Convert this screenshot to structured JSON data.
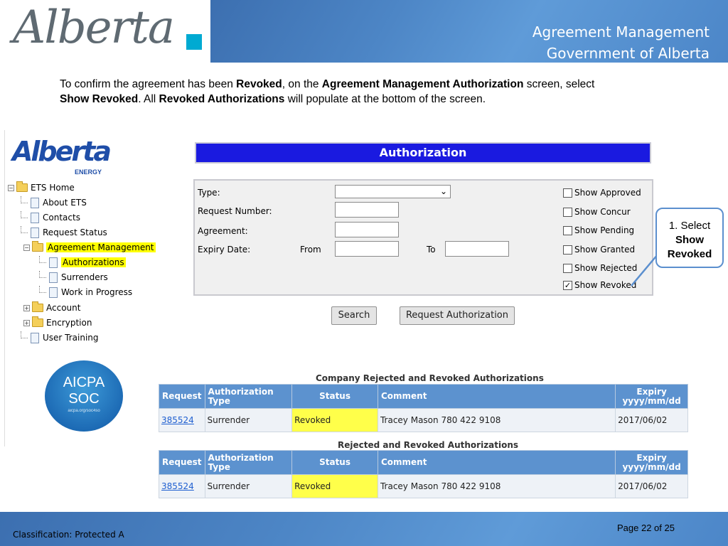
{
  "header": {
    "logo_text": "Alberta",
    "title_line1": "Agreement Management",
    "title_line2": "Government of Alberta"
  },
  "intro": {
    "p1": "To confirm the agreement has been ",
    "b1": "Revoked",
    "p2": ", on the ",
    "b2": "Agreement Management Authorization",
    "p3": " screen, select ",
    "b3": "Show Revoked",
    "p4": ".  All ",
    "b4": "Revoked Authorizations",
    "p5": " will populate at the bottom of the screen."
  },
  "nav": {
    "logo_word": "Alberta",
    "logo_sub": "ENERGY",
    "items": [
      {
        "label": "ETS Home"
      },
      {
        "label": "About ETS"
      },
      {
        "label": "Contacts"
      },
      {
        "label": "Request Status"
      },
      {
        "label": "Agreement Management"
      },
      {
        "label": "Authorizations"
      },
      {
        "label": "Surrenders"
      },
      {
        "label": "Work in Progress"
      },
      {
        "label": "Account"
      },
      {
        "label": "Encryption"
      },
      {
        "label": "User Training"
      }
    ],
    "aicpa": {
      "line1": "AICPA",
      "line2": "SOC",
      "line3": "aicpa.org/soc4so"
    }
  },
  "auth": {
    "title": "Authorization",
    "labels": {
      "type": "Type:",
      "request_number": "Request Number:",
      "agreement": "Agreement:",
      "expiry_date": "Expiry Date:",
      "from": "From",
      "to": "To"
    },
    "checkboxes": [
      {
        "label": "Show Approved",
        "checked": false
      },
      {
        "label": "Show Concur",
        "checked": false
      },
      {
        "label": "Show Pending",
        "checked": false
      },
      {
        "label": "Show Granted",
        "checked": false
      },
      {
        "label": "Show Rejected",
        "checked": false
      },
      {
        "label": "Show Revoked",
        "checked": true
      }
    ],
    "buttons": {
      "search": "Search",
      "request": "Request Authorization"
    }
  },
  "callout": {
    "line1": "1. Select",
    "line2": "Show",
    "line3": "Revoked"
  },
  "tables": [
    {
      "caption": "Company Rejected and Revoked Authorizations",
      "headers": [
        "Request",
        "Authorization Type",
        "Status",
        "Comment",
        "Expiry yyyy/mm/dd"
      ],
      "rows": [
        [
          "385524",
          "Surrender",
          "Revoked",
          "Tracey Mason 780 422 9108",
          "2017/06/02"
        ]
      ]
    },
    {
      "caption": "Rejected and Revoked Authorizations",
      "headers": [
        "Request",
        "Authorization Type",
        "Status",
        "Comment",
        "Expiry yyyy/mm/dd"
      ],
      "rows": [
        [
          "385524",
          "Surrender",
          "Revoked",
          "Tracey Mason 780 422 9108",
          "2017/06/02"
        ]
      ]
    }
  ],
  "footer": {
    "classification": "Classification: Protected A",
    "page": "Page 22 of 25"
  },
  "colors": {
    "brand_blue": "#4d86c6",
    "highlight": "#ffff00",
    "auth_title_bg": "#1a1ae0"
  }
}
